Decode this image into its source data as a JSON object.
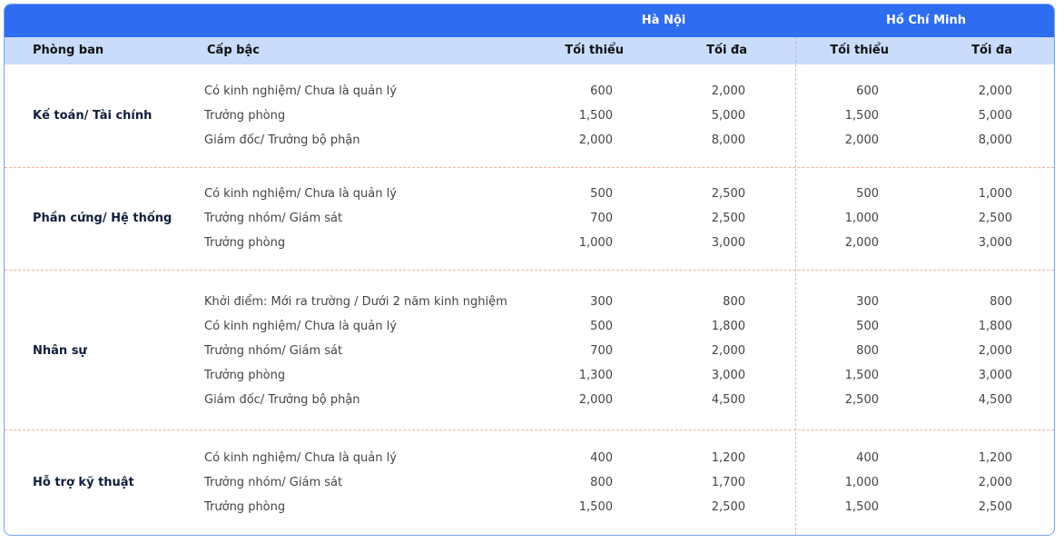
{
  "header": {
    "city1": "Hà Nội",
    "city2": "Hồ Chí Minh",
    "col_dept": "Phòng ban",
    "col_level": "Cấp bậc",
    "col_min": "Tối thiểu",
    "col_max": "Tối đa"
  },
  "groups": [
    {
      "dept": "Kế toán/ Tài chính",
      "rows": [
        {
          "level": "Có kinh nghiệm/ Chưa là quản lý",
          "hn_min": "600",
          "hn_max": "2,000",
          "hcm_min": "600",
          "hcm_max": "2,000"
        },
        {
          "level": "Trưởng phòng",
          "hn_min": "1,500",
          "hn_max": "5,000",
          "hcm_min": "1,500",
          "hcm_max": "5,000"
        },
        {
          "level": "Giám đốc/ Trưởng bộ phận",
          "hn_min": "2,000",
          "hn_max": "8,000",
          "hcm_min": "2,000",
          "hcm_max": "8,000"
        }
      ]
    },
    {
      "dept": "Phần cứng/ Hệ thống",
      "rows": [
        {
          "level": "Có kinh nghiệm/ Chưa là quản lý",
          "hn_min": "500",
          "hn_max": "2,500",
          "hcm_min": "500",
          "hcm_max": "1,000"
        },
        {
          "level": "Trưởng nhóm/ Giám sát",
          "hn_min": "700",
          "hn_max": "2,500",
          "hcm_min": "1,000",
          "hcm_max": "2,500"
        },
        {
          "level": "Trưởng phòng",
          "hn_min": "1,000",
          "hn_max": "3,000",
          "hcm_min": "2,000",
          "hcm_max": "3,000"
        }
      ]
    },
    {
      "dept": "Nhân sự",
      "rows": [
        {
          "level": "Khởi điểm: Mới ra trường / Dưới 2 năm kinh nghiệm",
          "hn_min": "300",
          "hn_max": "800",
          "hcm_min": "300",
          "hcm_max": "800"
        },
        {
          "level": "Có kinh nghiệm/ Chưa là quản lý",
          "hn_min": "500",
          "hn_max": "1,800",
          "hcm_min": "500",
          "hcm_max": "1,800"
        },
        {
          "level": "Trưởng nhóm/ Giám sát",
          "hn_min": "700",
          "hn_max": "2,000",
          "hcm_min": "800",
          "hcm_max": "2,000"
        },
        {
          "level": "Trưởng phòng",
          "hn_min": "1,300",
          "hn_max": "3,000",
          "hcm_min": "1,500",
          "hcm_max": "3,000"
        },
        {
          "level": "Giám đốc/ Trưởng bộ phận",
          "hn_min": "2,000",
          "hn_max": "4,500",
          "hcm_min": "2,500",
          "hcm_max": "4,500"
        }
      ]
    },
    {
      "dept": "Hỗ trợ kỹ thuật",
      "rows": [
        {
          "level": "Có kinh nghiệm/ Chưa là quản lý",
          "hn_min": "400",
          "hn_max": "1,200",
          "hcm_min": "400",
          "hcm_max": "1,200"
        },
        {
          "level": "Trưởng nhóm/ Giám sát",
          "hn_min": "800",
          "hn_max": "1,700",
          "hcm_min": "1,000",
          "hcm_max": "2,000"
        },
        {
          "level": "Trưởng phòng",
          "hn_min": "1,500",
          "hn_max": "2,500",
          "hcm_min": "1,500",
          "hcm_max": "2,500"
        }
      ]
    }
  ]
}
